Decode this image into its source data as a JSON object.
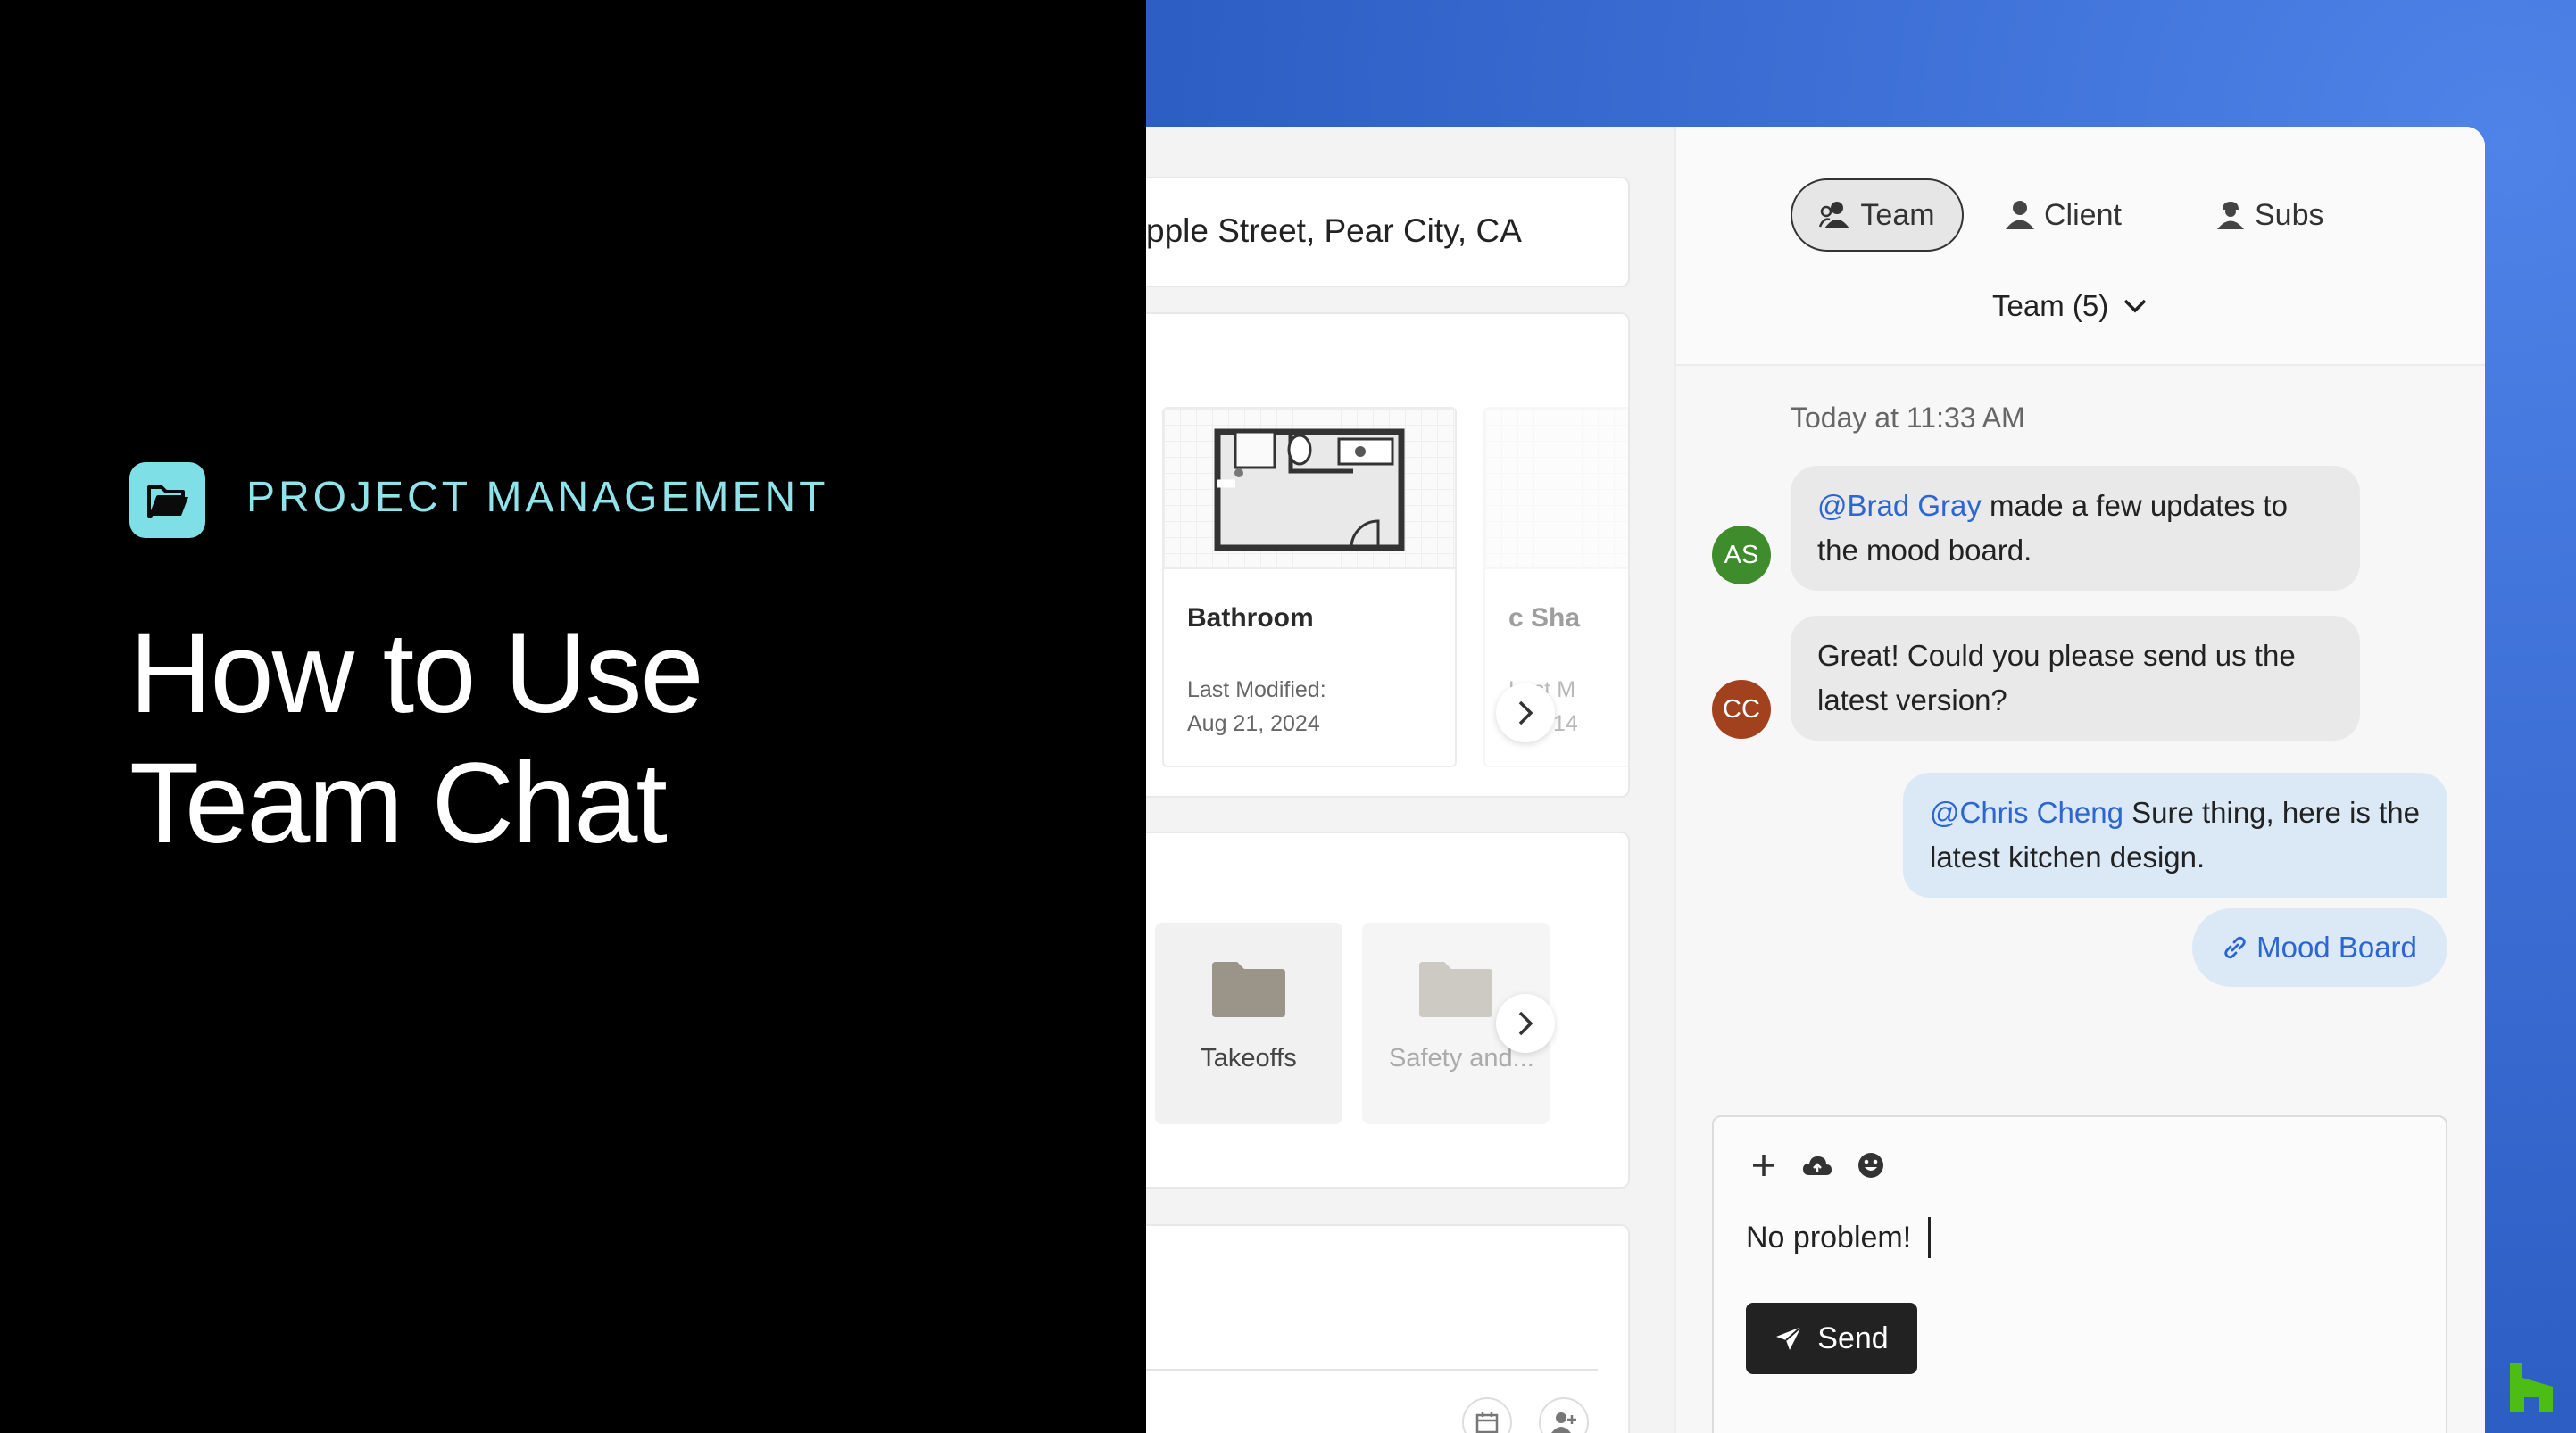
{
  "intro": {
    "category": "PROJECT MANAGEMENT",
    "title_line1": "How to Use",
    "title_line2": "Team Chat"
  },
  "project": {
    "address": "pple Street, Pear City, CA",
    "files": [
      {
        "name": "Bathroom",
        "modified_label": "Last Modified:",
        "modified_date": "Aug 21, 2024"
      },
      {
        "name": "c Sha",
        "modified_label": "Last M",
        "modified_date": "Feb 14"
      }
    ],
    "folders": [
      {
        "name": "Takeoffs"
      },
      {
        "name": "Safety and..."
      }
    ]
  },
  "chat": {
    "tabs": [
      {
        "label": "Team",
        "active": true
      },
      {
        "label": "Client",
        "active": false
      },
      {
        "label": "Subs",
        "active": false
      }
    ],
    "channel_select": "Team (5)",
    "timestamp": "Today at 11:33 AM",
    "messages": [
      {
        "avatar": "AS",
        "mention": "@Brad Gray",
        "text": " made a few updates to the mood board."
      },
      {
        "avatar": "CC",
        "text": "Great! Could you please send us the latest version?"
      },
      {
        "mention": "@Chris Cheng",
        "text": " Sure thing, here is the latest kitchen design."
      }
    ],
    "attachment_link": "Mood Board",
    "composer": {
      "value": "No problem!",
      "send_label": "Send"
    }
  },
  "colors": {
    "accent_blue": "#2c66d1",
    "brand_teal": "#8fe3ea",
    "avatar_as": "#3e8c2c",
    "avatar_cc": "#a2411e",
    "houzz_green": "#4dbc15"
  }
}
